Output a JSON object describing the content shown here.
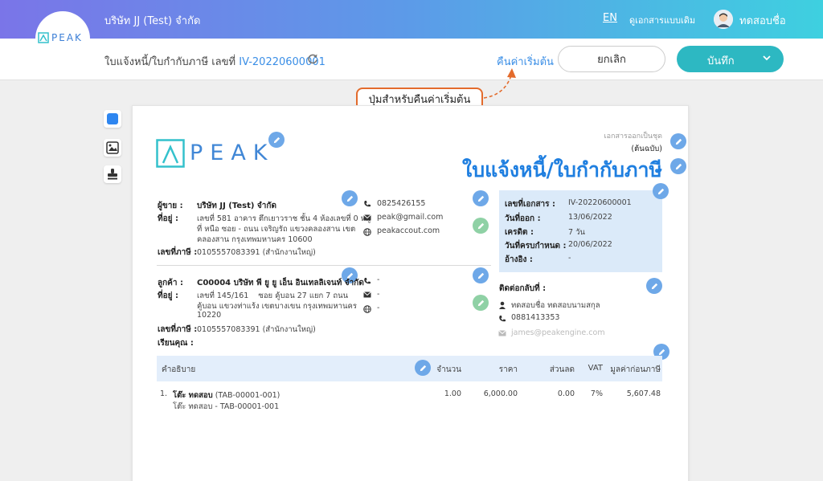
{
  "header": {
    "company": "บริษัท JJ (Test) จำกัด",
    "lang": "EN",
    "old_view": "ดูเอกสารแบบเดิม",
    "username": "ทดสอบชื่อ",
    "logo_text": "PEAK"
  },
  "toolbar": {
    "doc_title": "ใบแจ้งหนี้/ใบกำกับภาษี เลขที่ ",
    "doc_number": "IV-20220600001",
    "reset_label": "คืนค่าเริ่มต้น",
    "cancel_label": "ยกเลิก",
    "save_label": "บันทึก"
  },
  "callout": {
    "text": "ปุ่มสำหรับคืนค่าเริ่มต้น"
  },
  "document": {
    "logo_text": "PEAK",
    "copy_type_1": "เอกสารออกเป็นชุด",
    "copy_type_2": "(ต้นฉบับ)",
    "title": "ใบแจ้งหนี้/ใบกำกับภาษี",
    "seller": {
      "label": "ผู้ขาย :",
      "name": "บริษัท JJ (Test) จำกัด",
      "address_label": "ที่อยู่ :",
      "address_1": "เลขที่ 581 อาคาร ตึกเยาวราช ชั้น 4 ห้องเลขที่ 0 หมู่",
      "address_2": "ที่ หนือ ซอย - ถนน เจริญรัถ แขวงคลองสาน เขต",
      "address_3": "คลองสาน กรุงเทพมหานคร 10600",
      "tax_label": "เลขที่ภาษี :",
      "tax_id": "0105557083391 (สำนักงานใหญ่)",
      "phone": "0825426155",
      "email": "peak@gmail.com",
      "website": "peakaccout.com"
    },
    "customer": {
      "label": "ลูกค้า :",
      "name": "C00004 บริษัท พี ยู ยู เอ็น อินเทลลิเจนท์ จำกัด",
      "address_label": "ที่อยู่ :",
      "address_1": "เลขที่ 145/161    ซอย คู้บอน 27 แยก 7 ถนน",
      "address_2": "คู้บอน  แขวงท่าแร้ง เขตบางเขน กรุงเทพมหานคร",
      "address_3": "10220",
      "tax_label": "เลขที่ภาษี :",
      "tax_id": "0105557083391 (สำนักงานใหญ่)",
      "attn_label": "เรียนคุณ :",
      "phone": "-",
      "email": "-",
      "website": "-"
    },
    "info": {
      "doc_no_label": "เลขที่เอกสาร :",
      "doc_no": "IV-20220600001",
      "issue_label": "วันที่ออก :",
      "issue_date": "13/06/2022",
      "credit_label": "เครดิต :",
      "credit": "7 วัน",
      "due_label": "วันที่ครบกำหนด :",
      "due_date": "20/06/2022",
      "ref_label": "อ้างอิง :",
      "ref": "-"
    },
    "contact": {
      "label": "ติดต่อกลับที่ :",
      "name": "ทดสอบชื่อ ทดสอบนามสกุล",
      "phone": "0881413353",
      "email": "james@peakengine.com"
    },
    "table": {
      "headers": [
        "คำอธิบาย",
        "จำนวน",
        "ราคา",
        "ส่วนลด",
        "VAT",
        "มูลค่าก่อนภาษี"
      ],
      "rows": [
        {
          "no": "1.",
          "name": "โต๊ะ ทดสอบ",
          "code": "(TAB-00001-001)",
          "desc": "โต๊ะ ทดสอบ - TAB-00001-001",
          "qty": "1.00",
          "price": "6,000.00",
          "discount": "0.00",
          "vat": "7%",
          "amount": "5,607.48"
        }
      ]
    }
  }
}
